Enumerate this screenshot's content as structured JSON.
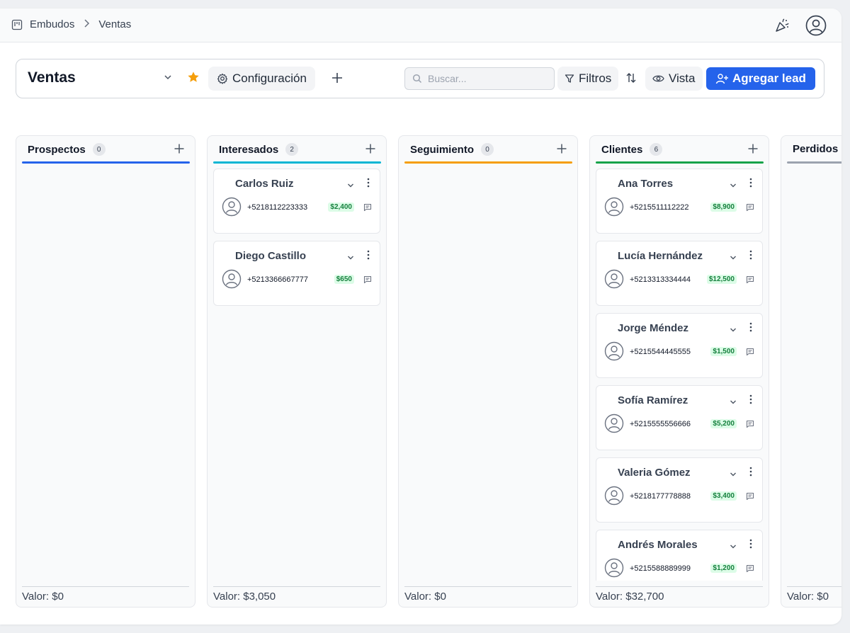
{
  "breadcrumb": {
    "items": [
      "Embudos",
      "Ventas"
    ]
  },
  "header": {
    "title": "Ventas",
    "config_label": "Configuración",
    "search_placeholder": "Buscar...",
    "filters_label": "Filtros",
    "view_label": "Vista",
    "add_lead_label": "Agregar lead"
  },
  "columns": [
    {
      "title": "Prospectos",
      "count": "0",
      "color": "#2563eb",
      "footer": "Valor: $0",
      "cards": []
    },
    {
      "title": "Interesados",
      "count": "2",
      "color": "#06b6d4",
      "footer": "Valor: $3,050",
      "cards": [
        {
          "name": "Carlos Ruiz",
          "phone": "+5218112223333",
          "amount": "$2,400"
        },
        {
          "name": "Diego Castillo",
          "phone": "+5213366667777",
          "amount": "$650"
        }
      ]
    },
    {
      "title": "Seguimiento",
      "count": "0",
      "color": "#f59e0b",
      "footer": "Valor: $0",
      "cards": []
    },
    {
      "title": "Clientes",
      "count": "6",
      "color": "#16a34a",
      "footer": "Valor: $32,700",
      "cards": [
        {
          "name": "Ana Torres",
          "phone": "+5215511112222",
          "amount": "$8,900"
        },
        {
          "name": "Lucía Hernández",
          "phone": "+5213313334444",
          "amount": "$12,500"
        },
        {
          "name": "Jorge Méndez",
          "phone": "+5215544445555",
          "amount": "$1,500"
        },
        {
          "name": "Sofía Ramírez",
          "phone": "+5215555556666",
          "amount": "$5,200"
        },
        {
          "name": "Valeria Gómez",
          "phone": "+5218177778888",
          "amount": "$3,400"
        },
        {
          "name": "Andrés Morales",
          "phone": "+5215588889999",
          "amount": "$1,200"
        }
      ]
    },
    {
      "title": "Perdidos",
      "count": "",
      "color": "#9ca3af",
      "footer": "Valor: $0",
      "cards": []
    }
  ],
  "colors": {
    "accent": "#2563eb",
    "star": "#f59e0b",
    "amount_text": "#15803d",
    "amount_bg": "#dcfce7"
  },
  "icons": [
    "board-icon",
    "chevron-right-icon",
    "party-popper-icon",
    "user-circle-icon",
    "chevron-down-icon",
    "star-icon",
    "gear-icon",
    "plus-icon",
    "search-icon",
    "filter-icon",
    "sort-icon",
    "eye-icon",
    "user-plus-icon",
    "kebab-icon",
    "avatar-icon",
    "message-icon"
  ]
}
